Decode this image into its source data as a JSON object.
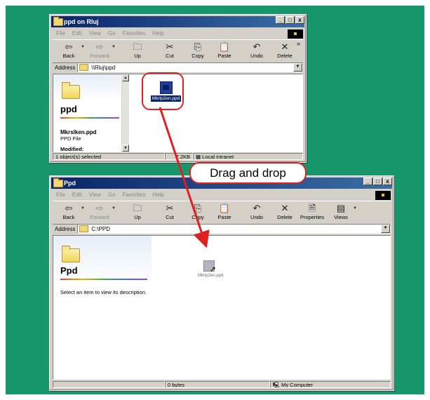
{
  "window1": {
    "title": "ppd on Rluj",
    "menu": [
      "File",
      "Edit",
      "View",
      "Go",
      "Favorites",
      "Help"
    ],
    "toolbar": [
      {
        "label": "Back",
        "icon": "back-arrow-icon",
        "glyph": "⇦"
      },
      {
        "label": "Forward",
        "icon": "forward-arrow-icon",
        "glyph": "⇨"
      },
      {
        "label": "Up",
        "icon": "up-folder-icon",
        "glyph": "🗀"
      },
      {
        "label": "Cut",
        "icon": "scissors-icon",
        "glyph": "✂"
      },
      {
        "label": "Copy",
        "icon": "copy-icon",
        "glyph": "⎘"
      },
      {
        "label": "Paste",
        "icon": "paste-icon",
        "glyph": "📋"
      },
      {
        "label": "Undo",
        "icon": "undo-icon",
        "glyph": "↶"
      },
      {
        "label": "Delete",
        "icon": "delete-x-icon",
        "glyph": "✕"
      }
    ],
    "overflow": "»",
    "address_label": "Address",
    "address": "\\\\Rluj\\ppd",
    "pane_title": "ppd",
    "file_name": "Mkrslken.ppd",
    "file_type": "PPD File",
    "modified_label": "Modified:",
    "selected_file": "Mkrlp2en.ppd",
    "status": [
      "1 object(s) selected",
      "7.2KB",
      "Local intranet"
    ]
  },
  "window2": {
    "title": "Ppd",
    "menu": [
      "File",
      "Edit",
      "View",
      "Go",
      "Favorites",
      "Help"
    ],
    "toolbar": [
      {
        "label": "Back",
        "icon": "back-arrow-icon",
        "glyph": "⇦"
      },
      {
        "label": "Forward",
        "icon": "forward-arrow-icon",
        "glyph": "⇨"
      },
      {
        "label": "Up",
        "icon": "up-folder-icon",
        "glyph": "🗀"
      },
      {
        "label": "Cut",
        "icon": "scissors-icon",
        "glyph": "✂"
      },
      {
        "label": "Copy",
        "icon": "copy-icon",
        "glyph": "⎘"
      },
      {
        "label": "Paste",
        "icon": "paste-icon",
        "glyph": "📋"
      },
      {
        "label": "Undo",
        "icon": "undo-icon",
        "glyph": "↶"
      },
      {
        "label": "Delete",
        "icon": "delete-x-icon",
        "glyph": "✕"
      },
      {
        "label": "Properties",
        "icon": "properties-icon",
        "glyph": "🗎"
      },
      {
        "label": "Views",
        "icon": "views-icon",
        "glyph": "▤"
      }
    ],
    "address_label": "Address",
    "address": "C:\\PPD",
    "pane_title": "Ppd",
    "description": "Select an item to view its description.",
    "dragged_file": "Mkrlp2en.ppd",
    "status": [
      "0 bytes",
      "My Computer"
    ]
  },
  "annotation": {
    "label": "Drag and drop"
  },
  "colors": {
    "background": "#16966a",
    "highlight": "#e02020",
    "titlebar": "#0a246a"
  }
}
